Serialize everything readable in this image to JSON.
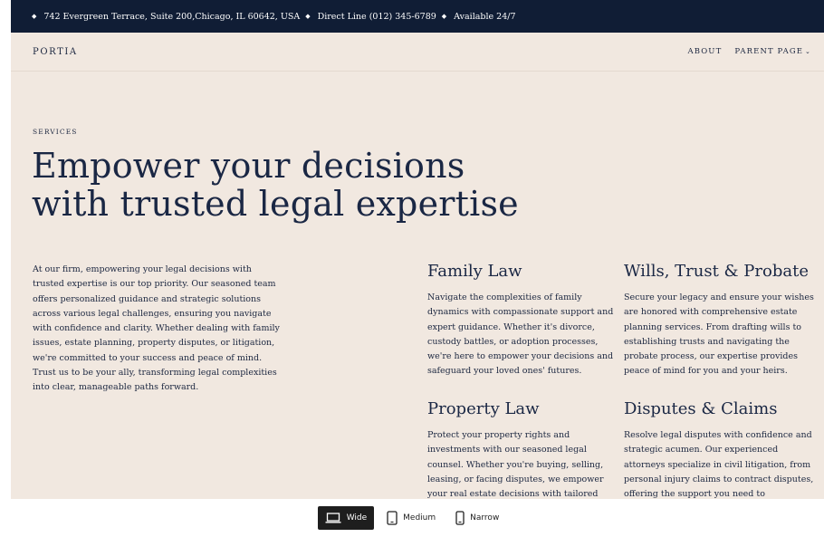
{
  "topbar": {
    "address": "742 Evergreen Terrace, Suite 200,Chicago, IL 60642, USA",
    "phone": "Direct Line (012) 345-6789",
    "availability": "Available 24/7"
  },
  "nav": {
    "brand": "PORTIA",
    "links": [
      "ABOUT",
      "PARENT PAGE"
    ]
  },
  "hero": {
    "eyebrow": "SERVICES",
    "headline_line1": "Empower your decisions",
    "headline_line2": "with trusted legal expertise",
    "intro": "At our firm, empowering your legal decisions with trusted expertise is our top priority. Our seasoned team offers personalized guidance and strategic solutions across various legal challenges, ensuring you navigate with confidence and clarity. Whether dealing with family issues, estate planning, property disputes, or litigation, we're committed to your success and peace of mind. Trust us to be your ally, transforming legal complexities into clear, manageable paths forward."
  },
  "services": [
    {
      "title": "Family Law",
      "body": "Navigate the complexities of family dynamics with compassionate support and expert guidance. Whether it's divorce, custody battles, or adoption processes, we're here to empower your decisions and safeguard your loved ones' futures."
    },
    {
      "title": "Wills, Trust & Probate",
      "body": "Secure your legacy and ensure your wishes are honored with comprehensive estate planning services. From drafting wills to establishing trusts and navigating the probate process, our expertise provides peace of mind for you and your heirs."
    },
    {
      "title": "Property Law",
      "body": "Protect your property rights and investments with our seasoned legal counsel. Whether you're buying, selling, leasing, or facing disputes, we empower your real estate decisions with tailored"
    },
    {
      "title": "Disputes & Claims",
      "body": "Resolve legal disputes with confidence and strategic acumen. Our experienced attorneys specialize in civil litigation, from personal injury claims to contract disputes, offering the support you need to"
    }
  ],
  "viewport_toolbar": {
    "options": [
      "Wide",
      "Medium",
      "Narrow"
    ],
    "selected": "Wide"
  }
}
